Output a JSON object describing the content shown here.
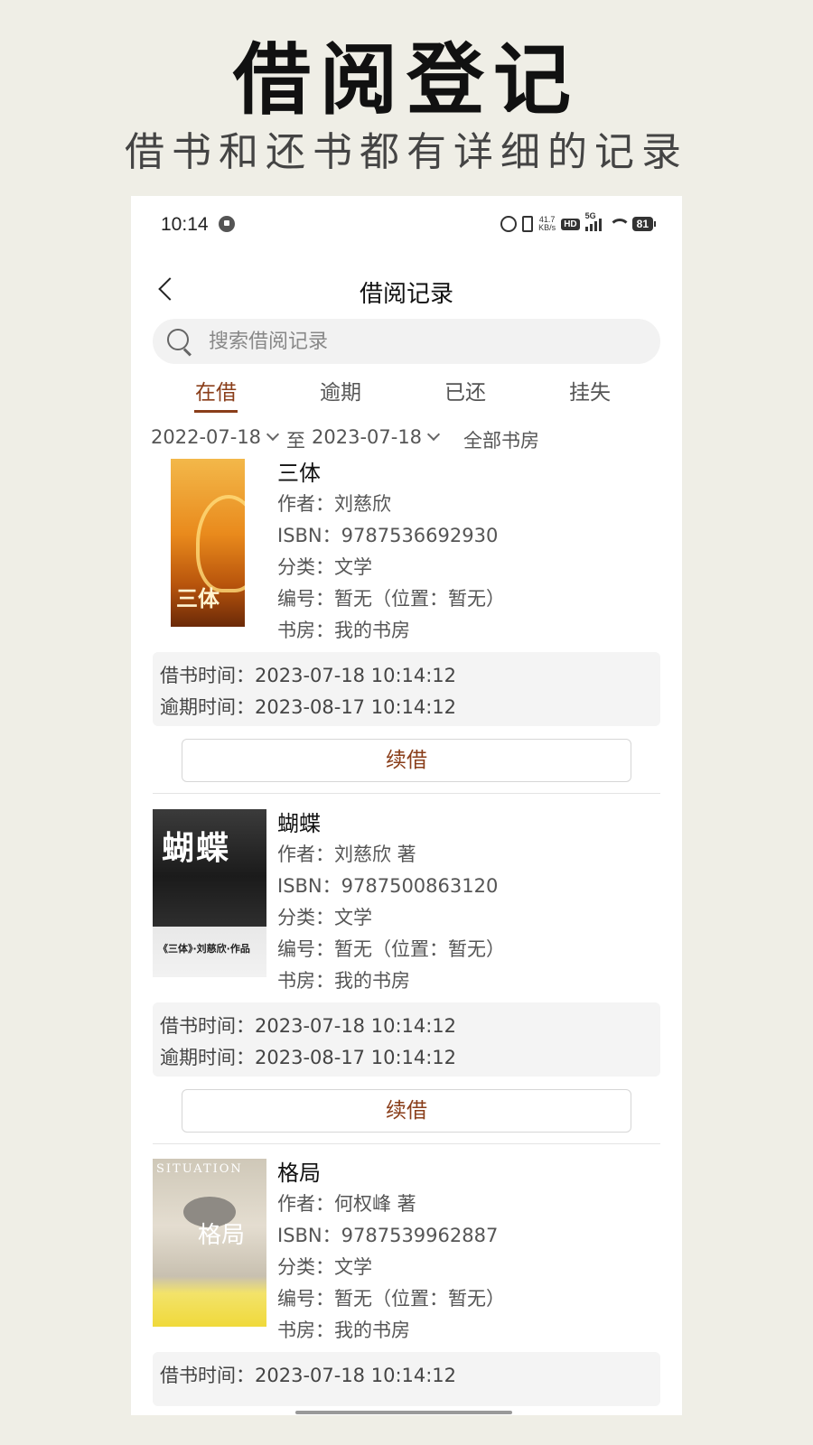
{
  "promo": {
    "title": "借阅登记",
    "subtitle": "借书和还书都有详细的记录"
  },
  "status_bar": {
    "time": "10:14",
    "net_speed_value": "41.7",
    "net_speed_unit": "KB/s",
    "hd": "HD",
    "network": "5G",
    "battery": "81"
  },
  "nav": {
    "title": "借阅记录"
  },
  "search": {
    "placeholder": "搜索借阅记录",
    "value": ""
  },
  "tabs": [
    {
      "label": "在借",
      "active": true
    },
    {
      "label": "逾期",
      "active": false
    },
    {
      "label": "已还",
      "active": false
    },
    {
      "label": "挂失",
      "active": false
    }
  ],
  "filters": {
    "start_date": "2022-07-18",
    "to_label": "至",
    "end_date": "2023-07-18",
    "room": "全部书房"
  },
  "books": [
    {
      "title": "三体",
      "author": "作者：刘慈欣",
      "isbn": "ISBN：9787536692930",
      "category": "分类：文学",
      "number": "编号：暂无（位置：暂无）",
      "room": "书房：我的书房",
      "borrow_time": "借书时间：2023-07-18 10:14:12",
      "overdue_time": "逾期时间：2023-08-17 10:14:12",
      "renew_label": "续借",
      "cover_text": "三体"
    },
    {
      "title": "蝴蝶",
      "author": "作者：刘慈欣 著",
      "isbn": "ISBN：9787500863120",
      "category": "分类：文学",
      "number": "编号：暂无（位置：暂无）",
      "room": "书房：我的书房",
      "borrow_time": "借书时间：2023-07-18 10:14:12",
      "overdue_time": "逾期时间：2023-08-17 10:14:12",
      "renew_label": "续借",
      "cover_text": "蝴蝶",
      "cover_sub": "《三体》·刘慈欣·作品"
    },
    {
      "title": "格局",
      "author": "作者：何权峰 著",
      "isbn": "ISBN：9787539962887",
      "category": "分类：文学",
      "number": "编号：暂无（位置：暂无）",
      "room": "书房：我的书房",
      "borrow_time": "借书时间：2023-07-18 10:14:12",
      "cover_text": "格局",
      "cover_sub": "SITUATION"
    }
  ],
  "colors": {
    "accent": "#8a3e1a",
    "page_bg": "#efeee6"
  }
}
